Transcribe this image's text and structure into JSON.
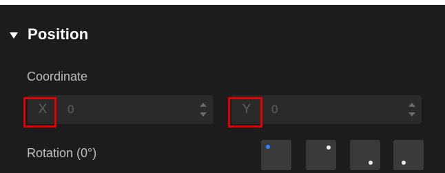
{
  "section": {
    "title": "Position",
    "coordinate_label": "Coordinate",
    "x": {
      "axis": "X",
      "value": "0"
    },
    "y": {
      "axis": "Y",
      "value": "0"
    },
    "rotation_label": "Rotation (0°)",
    "rotation_options": [
      {
        "name": "top-left",
        "selected": true
      },
      {
        "name": "top-right",
        "selected": false
      },
      {
        "name": "bottom-right",
        "selected": false
      },
      {
        "name": "bottom-right-alt",
        "selected": false
      }
    ]
  },
  "colors": {
    "panel_bg": "#1c1c1c",
    "field_bg": "#2a2a2a",
    "highlight_box": "#e00000",
    "selected_dot": "#2f86ff"
  }
}
